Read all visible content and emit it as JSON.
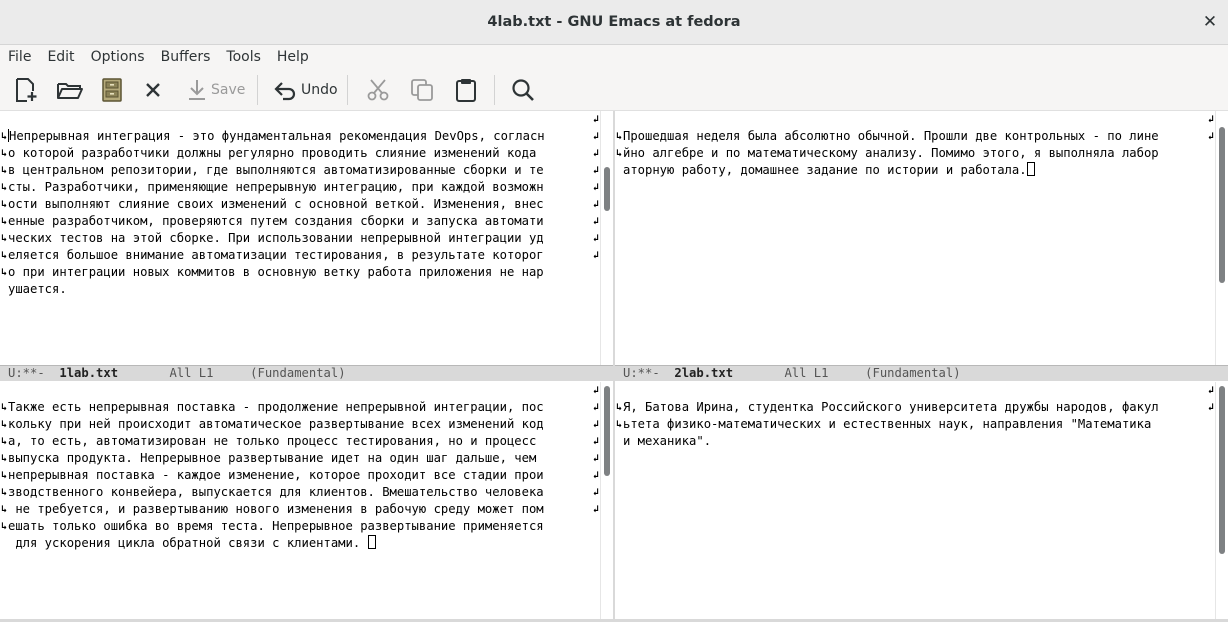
{
  "window": {
    "title": "4lab.txt - GNU Emacs at fedora",
    "close_glyph": "✕"
  },
  "menu": [
    "File",
    "Edit",
    "Options",
    "Buffers",
    "Tools",
    "Help"
  ],
  "toolbar": {
    "save_label": "Save",
    "undo_label": "Undo",
    "icons": [
      "new-file-icon",
      "open-folder-icon",
      "dired-icon",
      "close-buffer-icon",
      "save-icon",
      "undo-icon",
      "cut-icon",
      "copy-icon",
      "paste-icon",
      "search-icon"
    ]
  },
  "panes": {
    "top_left": {
      "lines": [
        "Непрерывная интеграция - это фундаментальная рекомендация DevOps, согласн",
        "о которой разработчики должны регулярно проводить слияние изменений кода ",
        "в центральном репозитории, где выполняются автоматизированные сборки и те",
        "сты. Разработчики, применяющие непрерывную интеграцию, при каждой возможн",
        "ости выполняют слияние своих изменений с основной веткой. Изменения, внес",
        "енные разработчиком, проверяются путем создания сборки и запуска автомати",
        "ческих тестов на этой сборке. При использовании непрерывной интеграции уд",
        "еляется большое внимание автоматизации тестирования, в результате которог",
        "о при интеграции новых коммитов в основную ветку работа приложения не нар",
        "ушается."
      ],
      "modeline": {
        "status": "U:**-",
        "buffer": "1lab.txt",
        "position": "All L1",
        "mode": "(Fundamental)"
      }
    },
    "top_right": {
      "lines": [
        "Прошедшая неделя была абсолютно обычной. Прошли две контрольных - по лине",
        "йно алгебре и по математическому анализу. Помимо этого, я выполняла лабор",
        "аторную работу, домашнее задание по истории и работала."
      ],
      "modeline": {
        "status": "U:**-",
        "buffer": "2lab.txt",
        "position": "All L1",
        "mode": "(Fundamental)"
      }
    },
    "bottom_left": {
      "lines": [
        "Также есть непрерывная поставка - продолжение непрерывной интеграции, пос",
        "кольку при ней происходит автоматическое развертывание всех изменений код",
        "а, то есть, автоматизирован не только процесс тестирования, но и процесс ",
        "выпуска продукта. Непрерывное развертывание идет на один шаг дальше, чем ",
        "непрерывная поставка - каждое изменение, которое проходит все стадии прои",
        "зводственного конвейера, выпускается для клиентов. Вмешательство человека",
        " не требуется, и развертыванию нового изменения в рабочую среду может пом",
        "ешать только ошибка во время теста. Непрерывное развертывание применяется",
        " для ускорения цикла обратной связи с клиентами. "
      ]
    },
    "bottom_right": {
      "lines": [
        "Я, Батова Ирина, студентка Российского университета дружбы народов, факул",
        "ьтета физико-математических и естественных наук, направления \"Математика ",
        "и механика\"."
      ]
    }
  }
}
